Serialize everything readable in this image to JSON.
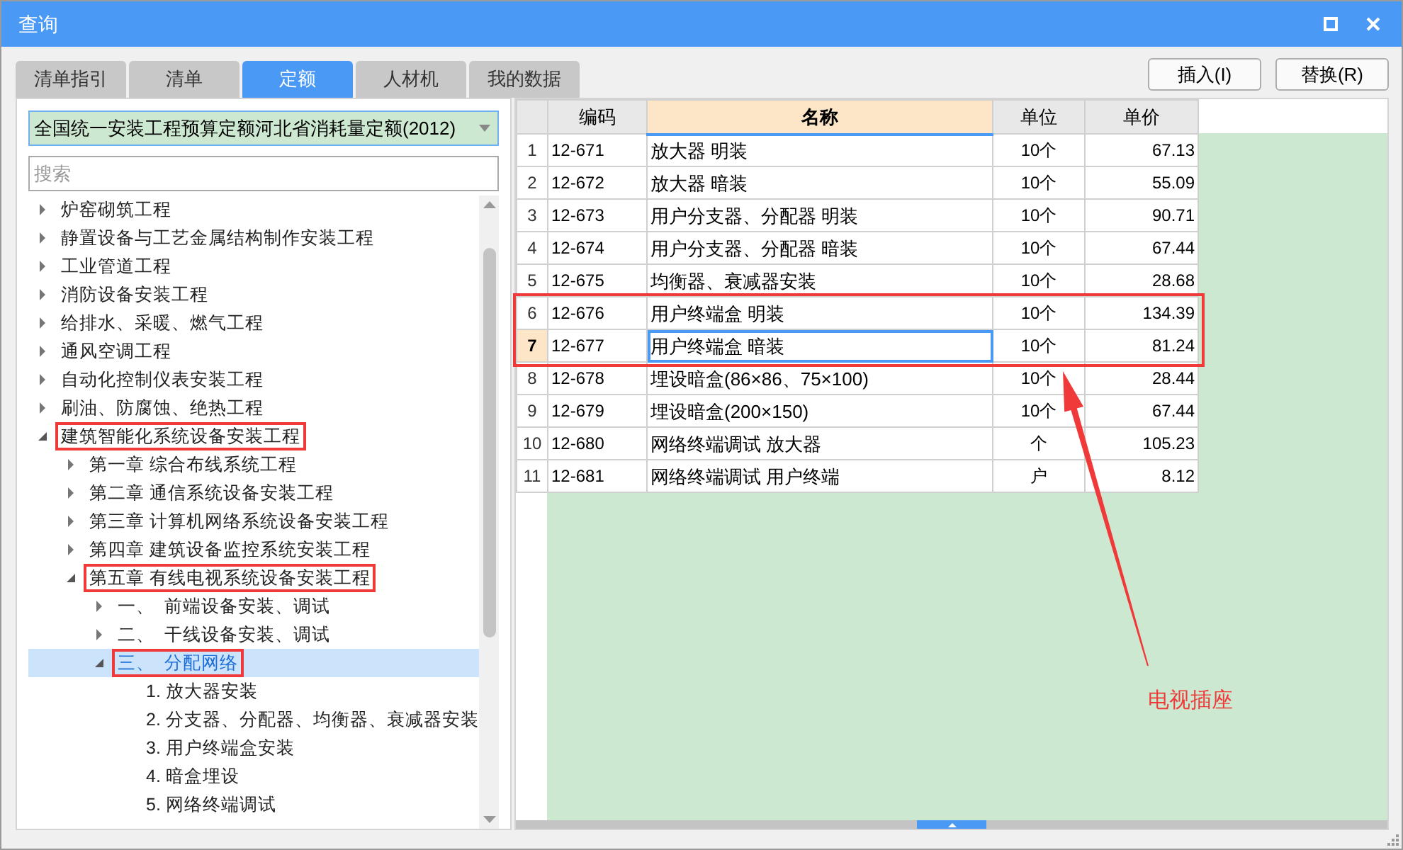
{
  "window": {
    "title": "查询"
  },
  "tabs": [
    {
      "label": "清单指引",
      "selected": false
    },
    {
      "label": "清单",
      "selected": false
    },
    {
      "label": "定额",
      "selected": true
    },
    {
      "label": "人材机",
      "selected": false
    },
    {
      "label": "我的数据",
      "selected": false
    }
  ],
  "buttons": [
    "插入(I)",
    "替换(R)"
  ],
  "library": {
    "value": "全国统一安装工程预算定额河北省消耗量定额(2012)"
  },
  "search": {
    "placeholder": "搜索"
  },
  "tree": [
    {
      "label": "炉窑砌筑工程",
      "expanded": false,
      "selected": false,
      "boxed": false
    },
    {
      "label": "静置设备与工艺金属结构制作安装工程",
      "expanded": false,
      "selected": false,
      "boxed": false
    },
    {
      "label": "工业管道工程",
      "expanded": false,
      "selected": false,
      "boxed": false
    },
    {
      "label": "消防设备安装工程",
      "expanded": false,
      "selected": false,
      "boxed": false
    },
    {
      "label": "给排水、采暖、燃气工程",
      "expanded": false,
      "selected": false,
      "boxed": false
    },
    {
      "label": "通风空调工程",
      "expanded": false,
      "selected": false,
      "boxed": false
    },
    {
      "label": "自动化控制仪表安装工程",
      "expanded": false,
      "selected": false,
      "boxed": false
    },
    {
      "label": "刷油、防腐蚀、绝热工程",
      "expanded": false,
      "selected": false,
      "boxed": false
    },
    {
      "label": "建筑智能化系统设备安装工程",
      "expanded": true,
      "selected": false,
      "boxed": true,
      "children": [
        {
          "label": "第一章 综合布线系统工程",
          "expanded": false,
          "selected": false,
          "boxed": false
        },
        {
          "label": "第二章 通信系统设备安装工程",
          "expanded": false,
          "selected": false,
          "boxed": false
        },
        {
          "label": "第三章 计算机网络系统设备安装工程",
          "expanded": false,
          "selected": false,
          "boxed": false
        },
        {
          "label": "第四章 建筑设备监控系统安装工程",
          "expanded": false,
          "selected": false,
          "boxed": false
        },
        {
          "label": "第五章 有线电视系统设备安装工程",
          "expanded": true,
          "selected": false,
          "boxed": true,
          "children": [
            {
              "label": "一、  前端设备安装、调试",
              "expanded": false,
              "selected": false,
              "boxed": false
            },
            {
              "label": "二、  干线设备安装、调试",
              "expanded": false,
              "selected": false,
              "boxed": false
            },
            {
              "label": "三、  分配网络",
              "expanded": true,
              "selected": true,
              "boxed": true,
              "children": [
                {
                  "label": "1. 放大器安装",
                  "selected": false,
                  "boxed": false
                },
                {
                  "label": "2. 分支器、分配器、均衡器、衰减器安装",
                  "selected": false,
                  "boxed": false
                },
                {
                  "label": "3. 用户终端盒安装",
                  "selected": false,
                  "boxed": false
                },
                {
                  "label": "4. 暗盒埋设",
                  "selected": false,
                  "boxed": false
                },
                {
                  "label": "5. 网络终端调试",
                  "selected": false,
                  "boxed": false
                }
              ]
            }
          ]
        }
      ]
    }
  ],
  "table": {
    "columns": [
      {
        "label": "编码",
        "selected": false
      },
      {
        "label": "名称",
        "selected": true
      },
      {
        "label": "单位",
        "selected": false
      },
      {
        "label": "单价",
        "selected": false
      }
    ],
    "rows": [
      {
        "index": "1",
        "code": "12-671",
        "name": "放大器 明装",
        "unit": "10个",
        "price": "67.13",
        "selected": false,
        "boxed": false
      },
      {
        "index": "2",
        "code": "12-672",
        "name": "放大器 暗装",
        "unit": "10个",
        "price": "55.09",
        "selected": false,
        "boxed": false
      },
      {
        "index": "3",
        "code": "12-673",
        "name": "用户分支器、分配器 明装",
        "unit": "10个",
        "price": "90.71",
        "selected": false,
        "boxed": false
      },
      {
        "index": "4",
        "code": "12-674",
        "name": "用户分支器、分配器 暗装",
        "unit": "10个",
        "price": "67.44",
        "selected": false,
        "boxed": false
      },
      {
        "index": "5",
        "code": "12-675",
        "name": "均衡器、衰减器安装",
        "unit": "10个",
        "price": "28.68",
        "selected": false,
        "boxed": false
      },
      {
        "index": "6",
        "code": "12-676",
        "name": "用户终端盒 明装",
        "unit": "10个",
        "price": "134.39",
        "selected": false,
        "boxed": true
      },
      {
        "index": "7",
        "code": "12-677",
        "name": "用户终端盒 暗装",
        "unit": "10个",
        "price": "81.24",
        "selected": true,
        "boxed": true
      },
      {
        "index": "8",
        "code": "12-678",
        "name": "埋设暗盒(86×86、75×100)",
        "unit": "10个",
        "price": "28.44",
        "selected": false,
        "boxed": false
      },
      {
        "index": "9",
        "code": "12-679",
        "name": "埋设暗盒(200×150)",
        "unit": "10个",
        "price": "67.44",
        "selected": false,
        "boxed": false
      },
      {
        "index": "10",
        "code": "12-680",
        "name": "网络终端调试 放大器",
        "unit": "个",
        "price": "105.23",
        "selected": false,
        "boxed": false
      },
      {
        "index": "11",
        "code": "12-681",
        "name": "网络终端调试 用户终端",
        "unit": "户",
        "price": "8.12",
        "selected": false,
        "boxed": false
      }
    ]
  },
  "annotation": {
    "label": "电视插座"
  }
}
